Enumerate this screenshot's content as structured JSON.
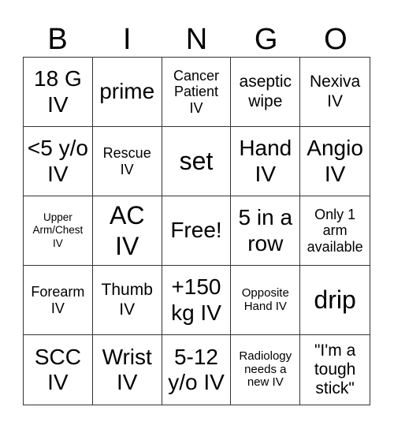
{
  "header": [
    "B",
    "I",
    "N",
    "G",
    "O"
  ],
  "cells": [
    {
      "text": "18 G\nIV",
      "size": "l"
    },
    {
      "text": "prime",
      "size": "l"
    },
    {
      "text": "Cancer\nPatient\nIV",
      "size": "s"
    },
    {
      "text": "aseptic\nwipe",
      "size": "m"
    },
    {
      "text": "Nexiva\nIV",
      "size": "m"
    },
    {
      "text": "<5 y/o\nIV",
      "size": "l"
    },
    {
      "text": "Rescue\nIV",
      "size": "s"
    },
    {
      "text": "set",
      "size": "xl"
    },
    {
      "text": "Hand\nIV",
      "size": "l"
    },
    {
      "text": "Angio\nIV",
      "size": "l"
    },
    {
      "text": "Upper\nArm/Chest\nIV",
      "size": "xxs"
    },
    {
      "text": "AC\nIV",
      "size": "xl"
    },
    {
      "text": "Free!",
      "size": "l"
    },
    {
      "text": "5 in a\nrow",
      "size": "l"
    },
    {
      "text": "Only 1\narm\navailable",
      "size": "s"
    },
    {
      "text": "Forearm\nIV",
      "size": "s"
    },
    {
      "text": "Thumb\nIV",
      "size": "m"
    },
    {
      "text": "+150\nkg IV",
      "size": "l"
    },
    {
      "text": "Opposite\nHand IV",
      "size": "xs"
    },
    {
      "text": "drip",
      "size": "xl"
    },
    {
      "text": "SCC\nIV",
      "size": "l"
    },
    {
      "text": "Wrist\nIV",
      "size": "l"
    },
    {
      "text": "5-12\ny/o IV",
      "size": "l"
    },
    {
      "text": "Radiology\nneeds a\nnew IV",
      "size": "xs"
    },
    {
      "text": "\"I'm a\ntough\nstick\"",
      "size": "m"
    }
  ]
}
